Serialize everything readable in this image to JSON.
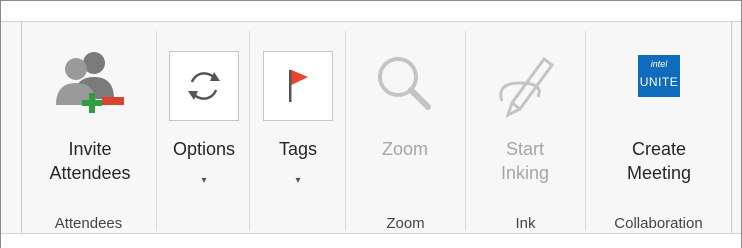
{
  "ribbon": {
    "groups": [
      {
        "label": "Attendees"
      },
      {
        "label": ""
      },
      {
        "label": ""
      },
      {
        "label": "Zoom"
      },
      {
        "label": "Ink"
      },
      {
        "label": "Collaboration"
      }
    ],
    "buttons": {
      "invite": {
        "line1": "Invite",
        "line2": "Attendees",
        "icon": "invite-attendees-icon"
      },
      "options": {
        "line1": "Options",
        "caret": "▾",
        "icon": "sync-icon"
      },
      "tags": {
        "line1": "Tags",
        "caret": "▾",
        "icon": "flag-icon"
      },
      "zoom": {
        "line1": "Zoom",
        "icon": "magnifier-icon",
        "disabled": true
      },
      "inking": {
        "line1": "Start",
        "line2": "Inking",
        "icon": "pen-icon",
        "disabled": true
      },
      "meeting": {
        "line1": "Create",
        "line2": "Meeting",
        "icon": "intel-unite-logo"
      }
    },
    "logo": {
      "brand": "intel",
      "product": "UNITE"
    }
  },
  "colors": {
    "accent_green": "#2e9e3e",
    "accent_red": "#d9432f",
    "flag_red": "#e8452c",
    "unite_blue": "#0f6cbd",
    "disabled_text": "#a6a6a6"
  }
}
